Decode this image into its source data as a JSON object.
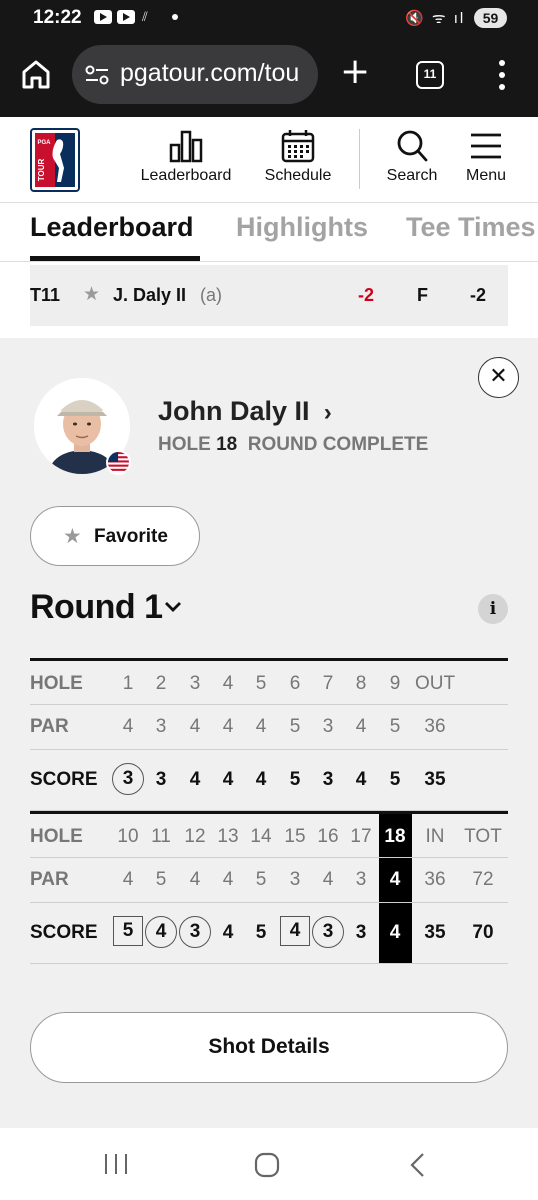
{
  "status_bar": {
    "time": "12:22",
    "battery": "59"
  },
  "browser": {
    "url": "pgatour.com/tou",
    "tab_count": "11"
  },
  "site_nav": {
    "items": [
      {
        "label": "Leaderboard",
        "icon": "bar-chart-icon"
      },
      {
        "label": "Schedule",
        "icon": "calendar-icon"
      },
      {
        "label": "Search",
        "icon": "search-icon"
      },
      {
        "label": "Menu",
        "icon": "hamburger-menu-icon"
      }
    ]
  },
  "tabs": [
    "Leaderboard",
    "Highlights",
    "Tee Times"
  ],
  "leaderboard_row": {
    "position": "T11",
    "name": "J. Daly II",
    "amateur": "(a)",
    "to_par": "-2",
    "thru": "F",
    "total": "-2"
  },
  "player": {
    "name": "John Daly II",
    "hole_label": "HOLE",
    "hole": "18",
    "status": "ROUND COMPLETE",
    "favorite_label": "Favorite"
  },
  "round": {
    "title": "Round 1"
  },
  "scorecard": {
    "front": {
      "hole_label": "HOLE",
      "par_label": "PAR",
      "score_label": "SCORE",
      "holes": [
        "1",
        "2",
        "3",
        "4",
        "5",
        "6",
        "7",
        "8",
        "9"
      ],
      "total_label": "OUT",
      "par": [
        "4",
        "3",
        "4",
        "4",
        "4",
        "5",
        "3",
        "4",
        "5"
      ],
      "par_total": "36",
      "score": [
        "3",
        "3",
        "4",
        "4",
        "4",
        "5",
        "3",
        "4",
        "5"
      ],
      "score_total": "35",
      "marks": [
        "circle",
        "",
        "",
        "",
        "",
        "",
        "",
        "",
        ""
      ]
    },
    "back": {
      "hole_label": "HOLE",
      "par_label": "PAR",
      "score_label": "SCORE",
      "holes": [
        "10",
        "11",
        "12",
        "13",
        "14",
        "15",
        "16",
        "17",
        "18"
      ],
      "in_label": "IN",
      "tot_label": "TOT",
      "par": [
        "4",
        "5",
        "4",
        "4",
        "5",
        "3",
        "4",
        "3",
        "4"
      ],
      "par_in": "36",
      "par_tot": "72",
      "score": [
        "5",
        "4",
        "3",
        "4",
        "5",
        "4",
        "3",
        "3",
        "4"
      ],
      "score_in": "35",
      "score_tot": "70",
      "marks": [
        "square",
        "circle",
        "circle",
        "",
        "",
        "square",
        "circle",
        "",
        ""
      ]
    },
    "current_hole": "18"
  },
  "shot_details_label": "Shot Details",
  "colors": {
    "red_score": "#d0021b",
    "panel_bg": "#f0f0f0",
    "highlight": "#000000"
  }
}
